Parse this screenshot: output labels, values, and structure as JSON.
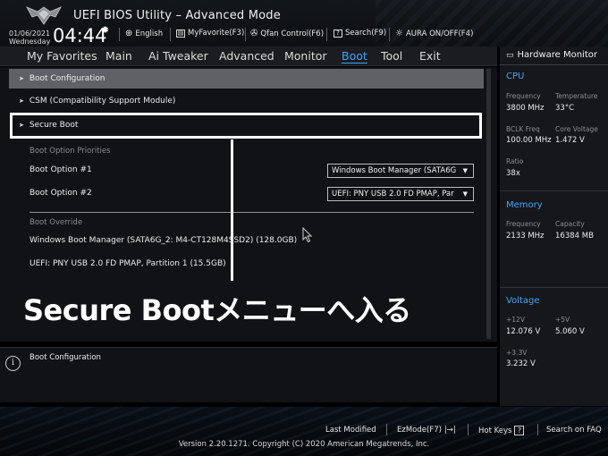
{
  "header": {
    "title": "UEFI BIOS Utility – Advanced Mode",
    "date": "01/06/2021",
    "day": "Wednesday",
    "time": "04:44",
    "items": [
      {
        "label": "English",
        "icon": "globe-icon"
      },
      {
        "label": "MyFavorite(F3)",
        "icon": "favorite-icon"
      },
      {
        "label": "Qfan Control(F6)",
        "icon": "fan-icon"
      },
      {
        "label": "Search(F9)",
        "icon": "search-icon"
      },
      {
        "label": "AURA ON/OFF(F4)",
        "icon": "aura-icon"
      }
    ]
  },
  "nav": {
    "tabs": [
      {
        "label": "My Favorites"
      },
      {
        "label": "Main"
      },
      {
        "label": "Ai Tweaker"
      },
      {
        "label": "Advanced"
      },
      {
        "label": "Monitor"
      },
      {
        "label": "Boot",
        "active": true
      },
      {
        "label": "Tool"
      },
      {
        "label": "Exit"
      }
    ]
  },
  "menu": {
    "items": [
      {
        "label": "Boot Configuration"
      },
      {
        "label": "CSM (Compatibility Support Module)"
      },
      {
        "label": "Secure Boot"
      }
    ],
    "priorities_label": "Boot Option Priorities",
    "options": [
      {
        "label": "Boot Option #1",
        "value": "Windows Boot Manager (SATA6G"
      },
      {
        "label": "Boot Option #2",
        "value": "UEFI: PNY USB 2.0 FD PMAP, Par"
      }
    ],
    "override_label": "Boot Override",
    "override_items": [
      "Windows Boot Manager (SATA6G_2: M4-CT128M4SSD2) (128.0GB)",
      "UEFI: PNY USB 2.0 FD PMAP, Partition 1 (15.5GB)"
    ]
  },
  "annotation": {
    "text": "Secure Bootメニューへ入る"
  },
  "help": {
    "text": "Boot Configuration"
  },
  "hardware_monitor": {
    "title": "Hardware Monitor",
    "cpu": {
      "label": "CPU",
      "frequency_label": "Frequency",
      "frequency": "3800 MHz",
      "temperature_label": "Temperature",
      "temperature": "33°C",
      "bclk_label": "BCLK Freq",
      "bclk": "100.00 MHz",
      "core_voltage_label": "Core Voltage",
      "core_voltage": "1.472 V",
      "ratio_label": "Ratio",
      "ratio": "38x"
    },
    "memory": {
      "label": "Memory",
      "frequency_label": "Frequency",
      "frequency": "2133 MHz",
      "capacity_label": "Capacity",
      "capacity": "16384 MB"
    },
    "voltage": {
      "label": "Voltage",
      "v12_label": "+12V",
      "v12": "12.076 V",
      "v5_label": "+5V",
      "v5": "5.060 V",
      "v33_label": "+3.3V",
      "v33": "3.232 V"
    }
  },
  "footer": {
    "last_modified": "Last Modified",
    "ezmode": "EzMode(F7)",
    "hotkeys": "Hot Keys",
    "hotkeys_key": "?",
    "faq": "Search on FAQ",
    "version": "Version 2.20.1271. Copyright (C) 2020 American Megatrends, Inc."
  },
  "colors": {
    "accent": "#3ea6ff",
    "selected_row": "#5f6166",
    "background": "#101215"
  }
}
